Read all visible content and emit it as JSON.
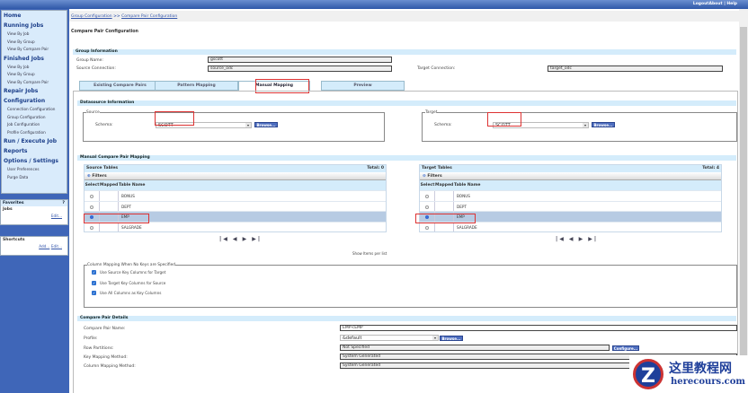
{
  "topbar": {
    "logout": "Logout",
    "about": "About",
    "help": "Help"
  },
  "sidebar": {
    "home": "Home",
    "running_jobs": "Running Jobs",
    "running_items": [
      "View By Job",
      "View By Group",
      "View By Compare Pair"
    ],
    "finished_jobs": "Finished Jobs",
    "finished_items": [
      "View By Job",
      "View By Group",
      "View By Compare Pair"
    ],
    "repair_jobs": "Repair Jobs",
    "configuration": "Configuration",
    "config_items": [
      "Connection Configuration",
      "Group Configuration",
      "Job Configuration",
      "Profile Configuration"
    ],
    "run_execute": "Run / Execute Job",
    "reports": "Reports",
    "options": "Options / Settings",
    "options_items": [
      "User Preferences",
      "Purge Data"
    ],
    "favorites": {
      "title": "Favorites",
      "help": "?",
      "jobs": "Jobs",
      "edit": "Edit..."
    },
    "shortcuts": {
      "title": "Shortcuts",
      "add": "Add...",
      "edit": "Edit..."
    }
  },
  "breadcrumb": {
    "first": "Group Configuration",
    "sep": ">>",
    "second": "Compare Pair Configuration"
  },
  "page_title": "Compare Pair Configuration",
  "group_info": {
    "header": "Group Information",
    "group_name_label": "Group Name:",
    "group_name": "gscott",
    "source_conn_label": "Source Connection:",
    "source_conn": "source_odc",
    "target_conn_label": "Target Connection:",
    "target_conn": "target_odc"
  },
  "tabs": [
    "Existing Compare Pairs",
    "Pattern Mapping",
    "Manual Mapping",
    "Preview"
  ],
  "datasource": {
    "header": "Datasource Information",
    "source_legend": "Source",
    "target_legend": "Target",
    "schema_label": "Schema:",
    "source_schema": "SCOTT",
    "target_schema": "SCOTT",
    "browse": "Browse..."
  },
  "mapping": {
    "header": "Manual Compare Pair Mapping",
    "filters": "Filters",
    "columns": [
      "Select",
      "Mapped",
      "Table Name"
    ],
    "source": {
      "title": "Source Tables",
      "total": "Total: 0"
    },
    "target": {
      "title": "Target Tables",
      "total": "Total: 4"
    },
    "rows": [
      "BONUS",
      "DEPT",
      "EMP",
      "SALGRADE"
    ],
    "selected_index": 2,
    "pager": "|◀ ◀  ▶ ▶|",
    "items_per_list": "Show Items per list"
  },
  "column_mapping": {
    "legend": "Column Mapping When No Keys are Specified",
    "options": [
      "Use Source Key Columns for Target",
      "Use Target Key Columns for Source",
      "Use All Columns as Key Columns"
    ]
  },
  "details": {
    "header": "Compare Pair Details",
    "name_label": "Compare Pair Name:",
    "name": "EMP<EMP",
    "profile_label": "Profile:",
    "profile": "&default",
    "browse": "Browse...",
    "row_partitions_label": "Row Partitions:",
    "row_partitions": "Not Specified",
    "configure": "Configure...",
    "key_mapping_label": "Key Mapping Method:",
    "key_mapping": "System Generated",
    "col_mapping_label": "Column Mapping Method:",
    "col_mapping": "System Generated"
  },
  "watermark": {
    "cn": "这里教程网",
    "url": "herecours.com"
  },
  "colors": {
    "accent": "#3f66b8",
    "header_bg": "#d4ecfb",
    "highlight": "#dd3333"
  }
}
